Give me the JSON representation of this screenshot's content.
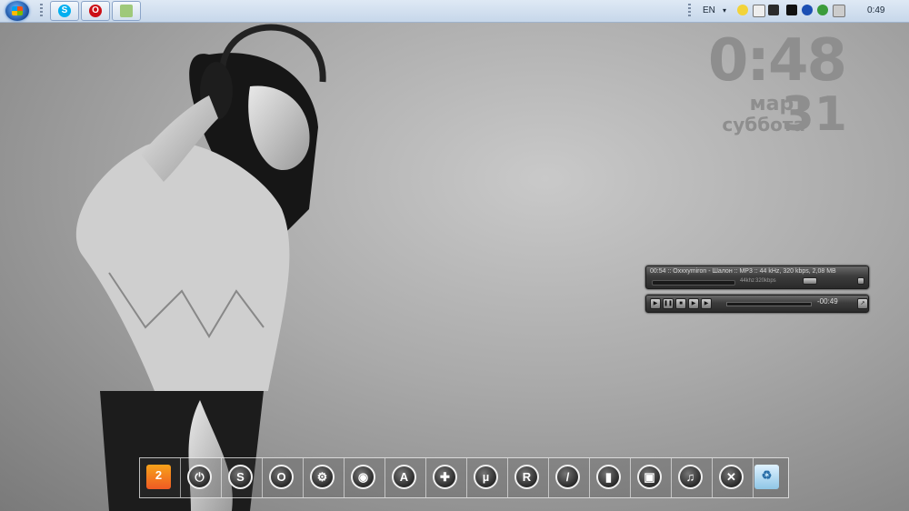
{
  "taskbar": {
    "pinned": [
      "skype-icon",
      "opera-icon",
      "file-manager-icon"
    ],
    "tray": {
      "language": "EN",
      "time": "0:49",
      "icons": [
        "norton-icon",
        "usb-icon",
        "steam-icon",
        "phone-icon",
        "bluetooth-icon",
        "utorrent-icon",
        "network-icon"
      ]
    }
  },
  "clock_widget": {
    "time": "0:48",
    "month": "март",
    "weekday": "суббота",
    "day": "31"
  },
  "player": {
    "title_line": "00:54 :: Oxxxymiron - Шалон :: MP3 :: 44 kHz, 320 kbps, 2,08 MB",
    "samplerate": "44khz",
    "bitrate": "320kbps",
    "time_remaining": "-00:49",
    "buttons": [
      "prev-icon",
      "pause-icon",
      "stop-icon",
      "play-icon",
      "next-icon"
    ]
  },
  "dock": {
    "items": [
      "2gis-icon",
      "power-icon",
      "skype-icon",
      "opera-icon",
      "steam-icon",
      "dota-icon",
      "aimp-icon",
      "gamepad-icon",
      "utorrent-icon",
      "registry-icon",
      "brush-icon",
      "book-icon",
      "windows-icon",
      "music-icon",
      "tools-icon",
      "recycle-bin-icon"
    ]
  },
  "colors": {
    "taskbar": "#dfe9f5",
    "player": "#3c3c3c",
    "clock_text": "#8e8e8e"
  }
}
